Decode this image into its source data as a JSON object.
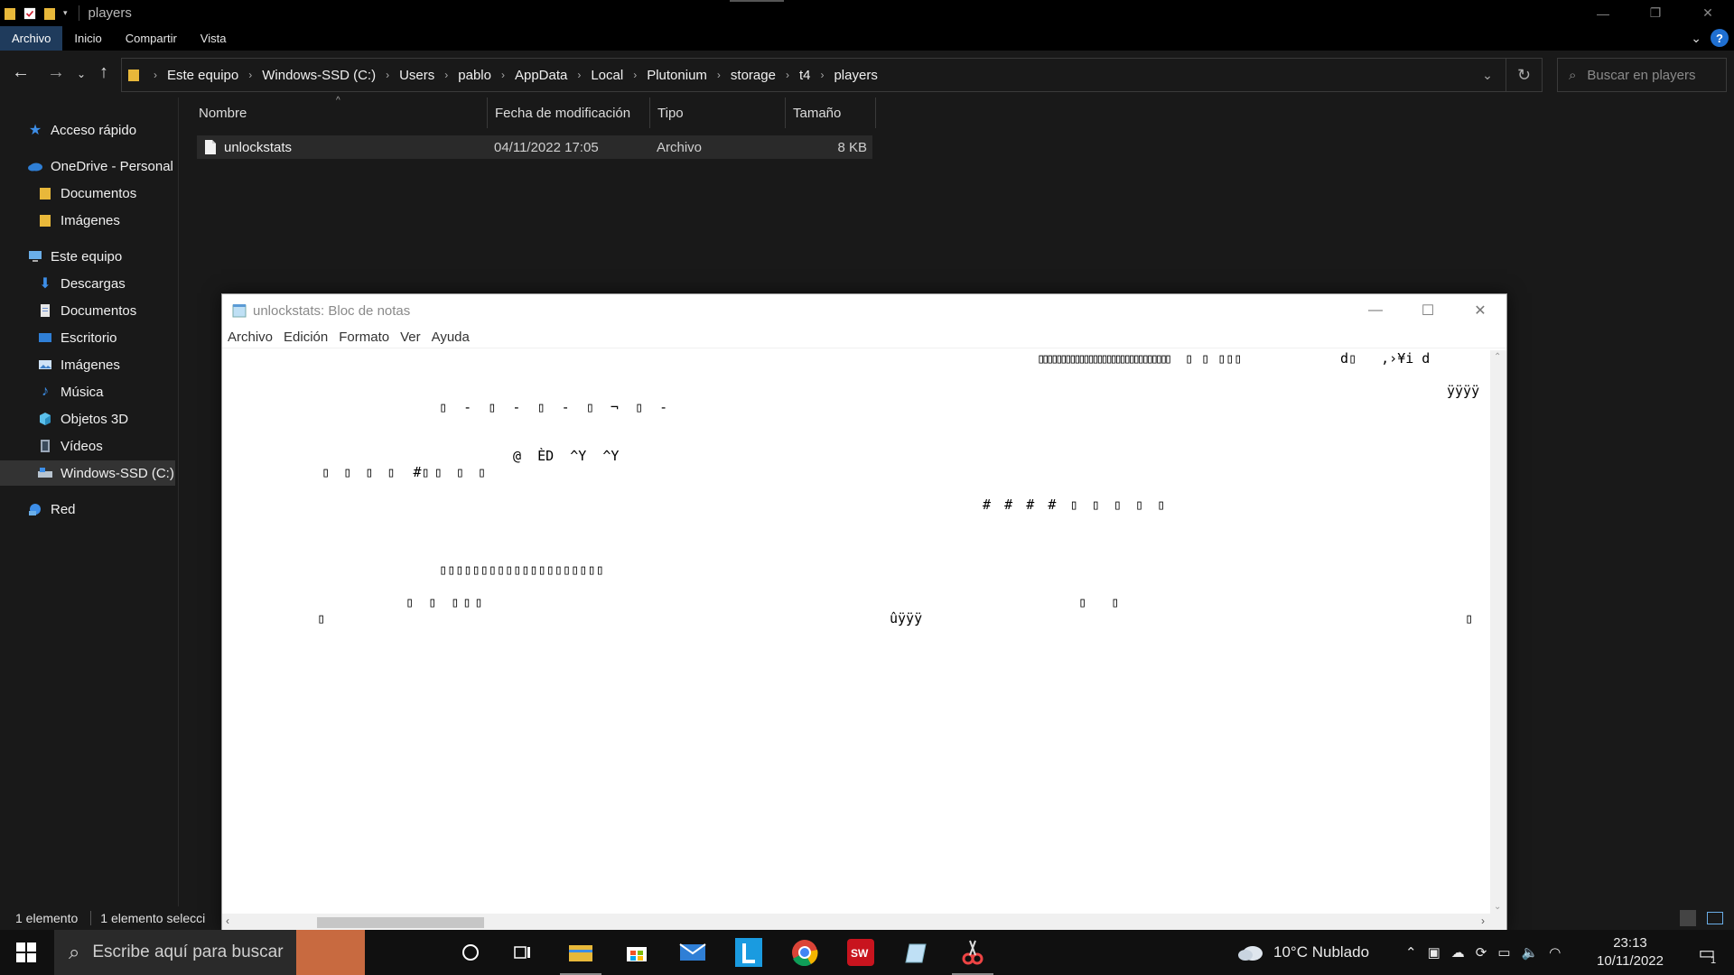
{
  "explorer": {
    "title": "players",
    "ribbon_tabs": [
      "Archivo",
      "Inicio",
      "Compartir",
      "Vista"
    ],
    "help_label": "?",
    "breadcrumbs": [
      "Este equipo",
      "Windows-SSD (C:)",
      "Users",
      "pablo",
      "AppData",
      "Local",
      "Plutonium",
      "storage",
      "t4",
      "players"
    ],
    "search_placeholder": "Buscar en players",
    "nav": {
      "quick_access": "Acceso rápido",
      "onedrive": "OneDrive - Personal",
      "onedrive_docs": "Documentos",
      "onedrive_images": "Imágenes",
      "this_pc": "Este equipo",
      "downloads": "Descargas",
      "documents": "Documentos",
      "desktop": "Escritorio",
      "images": "Imágenes",
      "music": "Música",
      "objects3d": "Objetos 3D",
      "videos": "Vídeos",
      "drive_c": "Windows-SSD (C:)",
      "network": "Red"
    },
    "columns": {
      "name": "Nombre",
      "modified": "Fecha de modificación",
      "type": "Tipo",
      "size": "Tamaño"
    },
    "file": {
      "name": "unlockstats",
      "modified": "04/11/2022 17:05",
      "type": "Archivo",
      "size": "8 KB"
    },
    "status": {
      "count": "1 elemento",
      "selected": "1 elemento selecci"
    }
  },
  "notepad": {
    "title": "unlockstats: Bloc de notas",
    "menu": [
      "Archivo",
      "Edición",
      "Formato",
      "Ver",
      "Ayuda"
    ],
    "content": {
      "l1_bars": "▯▯▯▯▯▯▯▯▯▯▯▯▯▯▯▯▯▯▯▯▯▯▯▯▯▯▯▯▯",
      "l1_mid": "▯ ▯ ▯▯▯",
      "l1_right": "d▯   ,›¥i d",
      "l2_right": "ÿÿÿÿ",
      "l3": "▯   -   ▯   -   ▯   -   ▯   ¬   ▯   -",
      "l4": "@  ÈD  ^Y  ^Y",
      "l5": "▯   ▯   ▯   ▯    #▯ ▯   ▯   ▯",
      "l6": "#   #   #   #   ▯   ▯   ▯   ▯   ▯",
      "l7": "▯   ▯   ▯   ▯   ▯   ▯   ▯   ▯   ▯   ▯   ▯   ▯   ▯   ▯   ▯   ▯   ▯   ▯            ▯   ▯",
      "l8a": "▯    ▯    ▯ ▯ ▯",
      "l8b": "▯   ▯",
      "l9a": "▯",
      "l9b": "ûÿÿÿ",
      "l9c": "▯"
    }
  },
  "taskbar": {
    "search_placeholder": "Escribe aquí para buscar",
    "weather": "10°C  Nublado",
    "time": "23:13",
    "date": "10/11/2022",
    "notifications": "1"
  }
}
